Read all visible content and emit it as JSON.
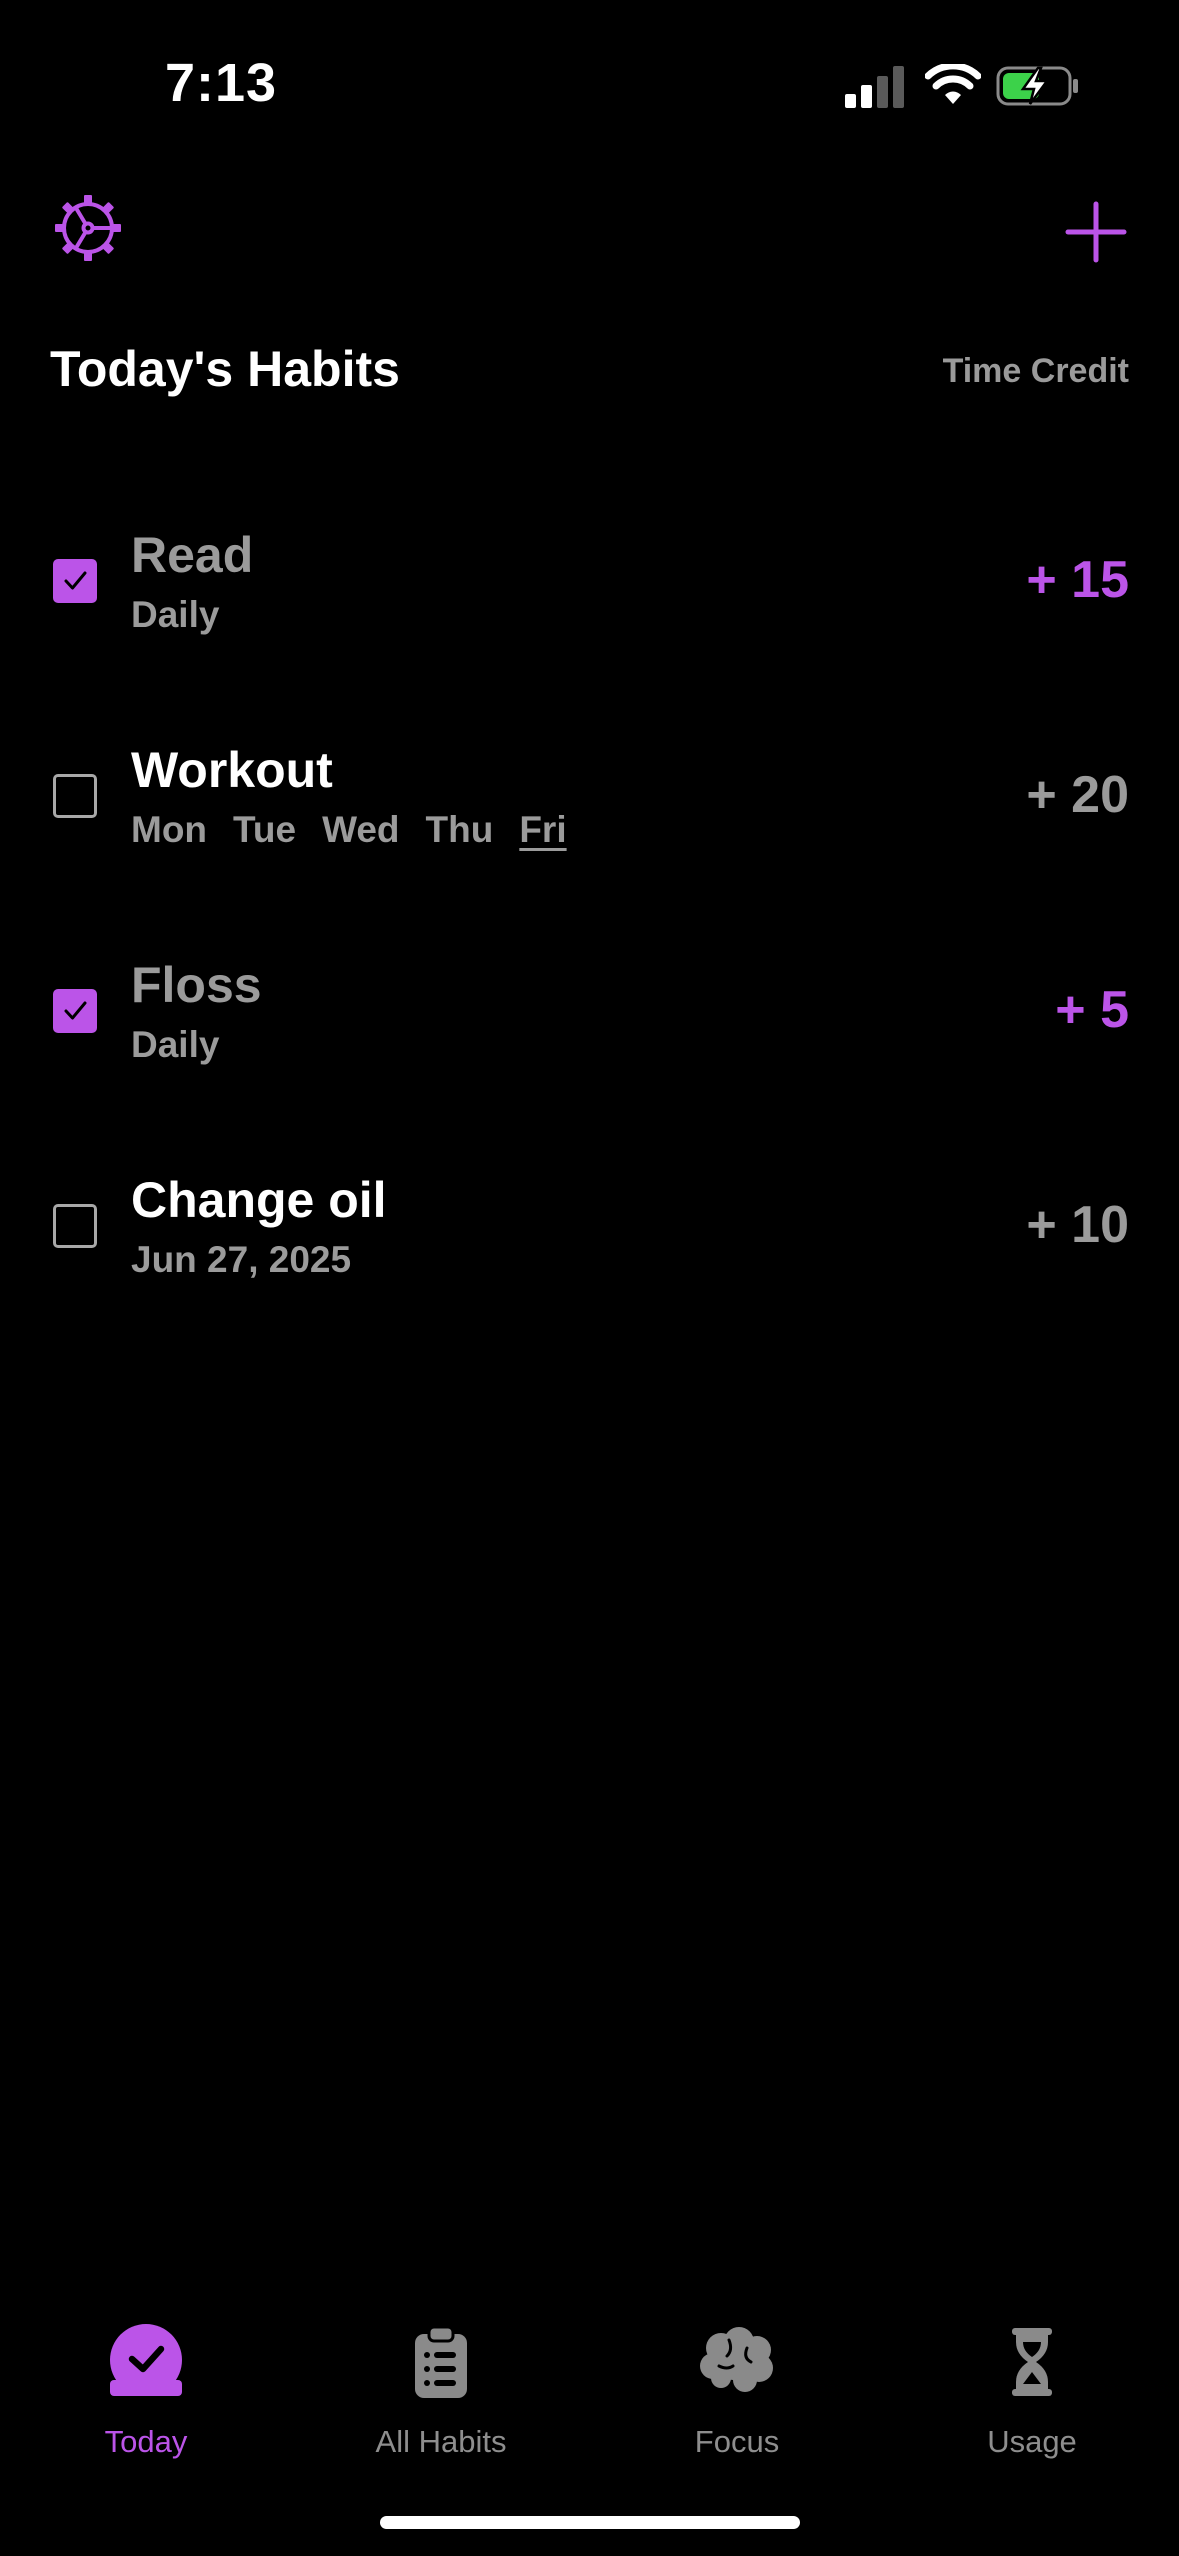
{
  "status_bar": {
    "time": "7:13"
  },
  "header": {
    "settings_icon": "gear-icon",
    "add_icon": "plus-icon",
    "title": "Today's Habits",
    "time_credit_label": "Time Credit"
  },
  "habits": [
    {
      "name": "Read",
      "schedule": "Daily",
      "credit": "+ 15",
      "checked": true
    },
    {
      "name": "Workout",
      "days": [
        "Mon",
        "Tue",
        "Wed",
        "Thu",
        "Fri"
      ],
      "today": "Fri",
      "credit": "+ 20",
      "checked": false
    },
    {
      "name": "Floss",
      "schedule": "Daily",
      "credit": "+ 5",
      "checked": true
    },
    {
      "name": "Change oil",
      "schedule": "Jun 27, 2025",
      "credit": "+ 10",
      "checked": false
    }
  ],
  "tabs": [
    {
      "label": "Today",
      "icon": "checkmark-badge-icon",
      "active": true
    },
    {
      "label": "All Habits",
      "icon": "clipboard-list-icon",
      "active": false
    },
    {
      "label": "Focus",
      "icon": "brain-icon",
      "active": false
    },
    {
      "label": "Usage",
      "icon": "hourglass-icon",
      "active": false
    }
  ],
  "colors": {
    "accent": "#bb54e8",
    "muted": "#9b9b9b",
    "background": "#000000"
  }
}
